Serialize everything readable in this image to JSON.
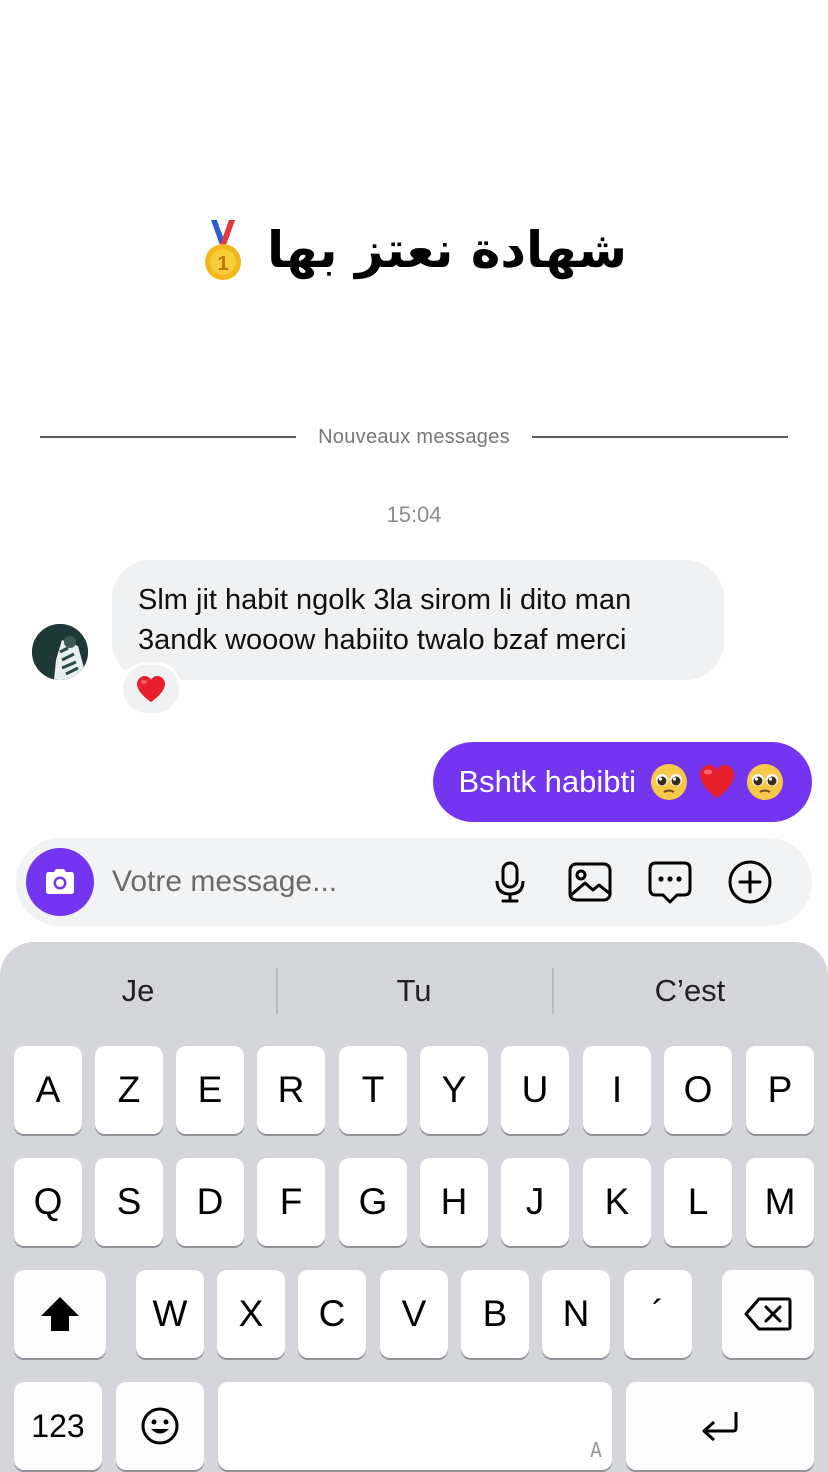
{
  "post": {
    "headline": "شهادة نعتز بها",
    "headline_icon": "gold-medal-icon"
  },
  "divider": {
    "label": "Nouveaux messages"
  },
  "timestamp": "15:04",
  "incoming": {
    "text_line1": "Slm jit habit ngolk 3la sirom li dito man",
    "text_line2": "3andk wooow habiito twalo bzaf merci",
    "reaction": "red-heart-icon"
  },
  "outgoing": {
    "text": "Bshtk habibti",
    "emojis": [
      "pleading-face-icon",
      "red-heart-icon",
      "pleading-face-icon"
    ]
  },
  "composer": {
    "placeholder": "Votre message...",
    "buttons": [
      "camera-icon",
      "microphone-icon",
      "image-icon",
      "chat-bubble-icon",
      "plus-circle-icon"
    ]
  },
  "keyboard": {
    "suggestions": [
      "Je",
      "Tu",
      "C’est"
    ],
    "row1": [
      "A",
      "Z",
      "E",
      "R",
      "T",
      "Y",
      "U",
      "I",
      "O",
      "P"
    ],
    "row2": [
      "Q",
      "S",
      "D",
      "F",
      "G",
      "H",
      "J",
      "K",
      "L",
      "M"
    ],
    "row3": [
      "W",
      "X",
      "C",
      "V",
      "B",
      "N",
      "´"
    ],
    "numbers_label": "123",
    "space_mark": "A"
  },
  "colors": {
    "accent": "#7435f0",
    "incoming_bubble": "#eff1f3",
    "keyboard_bg": "#d4d6dc"
  }
}
